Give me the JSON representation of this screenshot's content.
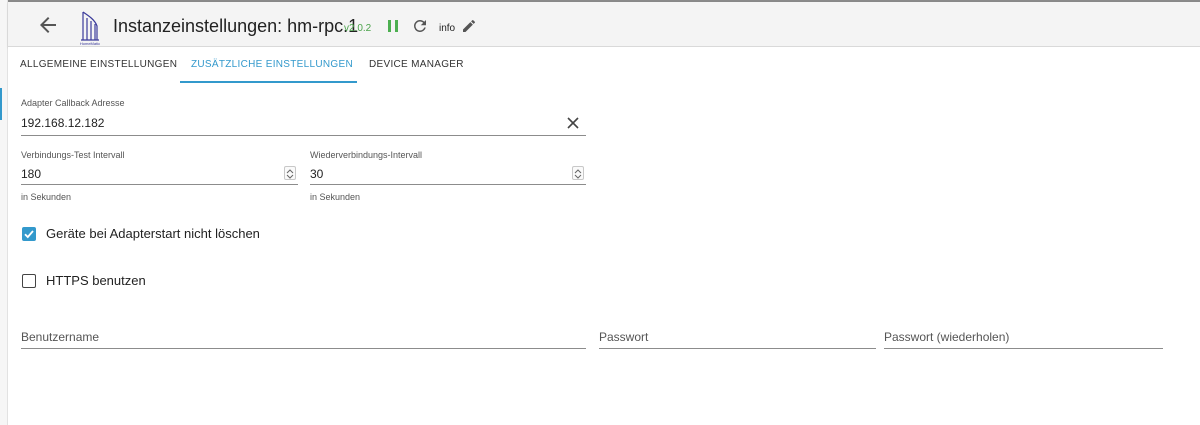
{
  "header": {
    "title": "Instanzeinstellungen: hm-rpc.1",
    "version": "v2.0.2",
    "info_label": "info",
    "logo_text": "HomeMatic",
    "version_color": "#4aa24a",
    "pause_color": "#4caf50"
  },
  "tabs": [
    {
      "label": "ALLGEMEINE EINSTELLUNGEN",
      "active": false
    },
    {
      "label": "ZUSÄTZLICHE EINSTELLUNGEN",
      "active": true
    },
    {
      "label": "DEVICE MANAGER",
      "active": false
    }
  ],
  "accent_color": "#3399cc",
  "form": {
    "callback": {
      "label": "Adapter Callback Adresse",
      "value": "192.168.12.182"
    },
    "test_interval": {
      "label": "Verbindungs-Test Intervall",
      "value": "180",
      "helper": "in Sekunden"
    },
    "reconnect_interval": {
      "label": "Wiederverbindungs-Intervall",
      "value": "30",
      "helper": "in Sekunden"
    },
    "keep_devices": {
      "label": "Geräte bei Adapterstart nicht löschen",
      "checked": true
    },
    "https": {
      "label": "HTTPS benutzen",
      "checked": false
    },
    "username": {
      "placeholder": "Benutzername"
    },
    "password": {
      "placeholder": "Passwort"
    },
    "password_repeat": {
      "placeholder": "Passwort (wiederholen)"
    }
  }
}
